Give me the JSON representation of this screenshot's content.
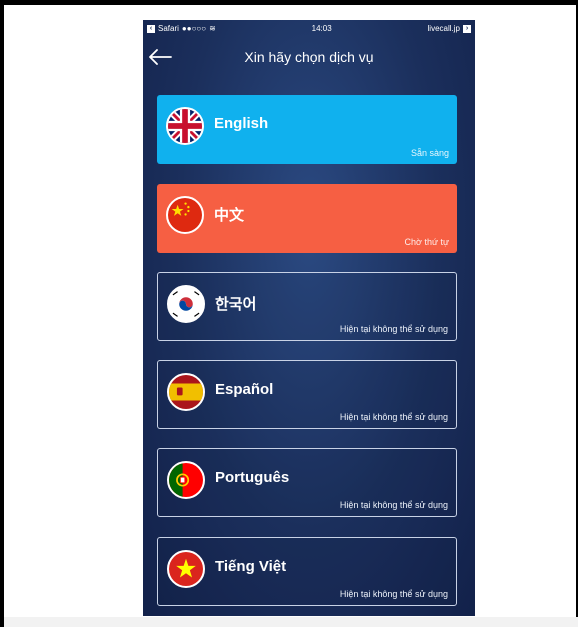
{
  "statusbar": {
    "carrier": "Safari",
    "signal": "●●○○○",
    "time": "14:03",
    "url": "livecall.jp"
  },
  "navbar": {
    "title": "Xin hãy chọn dịch vụ"
  },
  "services": [
    {
      "name": "English",
      "status": "Sẵn sàng",
      "flag": "uk-flag-icon"
    },
    {
      "name": "中文",
      "status": "Chờ thứ tự",
      "flag": "china-flag-icon"
    },
    {
      "name": "한국어",
      "status": "Hiện tại không thể sử dụng",
      "flag": "korea-flag-icon"
    },
    {
      "name": "Español",
      "status": "Hiện tại không thể sử dụng",
      "flag": "spain-flag-icon"
    },
    {
      "name": "Português",
      "status": "Hiện tại không thể sử dụng",
      "flag": "portugal-flag-icon"
    },
    {
      "name": "Tiếng Việt",
      "status": "Hiện tại không thể sử dụng",
      "flag": "vietnam-flag-icon"
    }
  ],
  "colors": {
    "available": "#10b1ee",
    "queue": "#f65f43",
    "background": "#1b2f5c"
  }
}
